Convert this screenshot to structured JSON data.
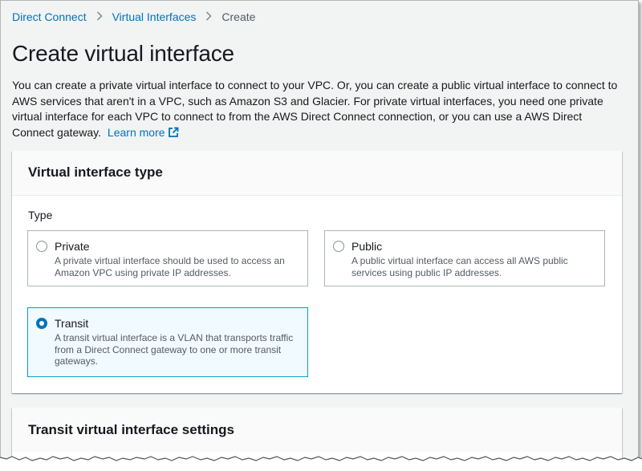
{
  "breadcrumb": {
    "items": [
      "Direct Connect",
      "Virtual Interfaces",
      "Create"
    ]
  },
  "page": {
    "title": "Create virtual interface",
    "intro": "You can create a private virtual interface to connect to your VPC. Or, you can create a public virtual interface to connect to AWS services that aren't in a VPC, such as Amazon S3 and Glacier. For private virtual interfaces, you need one private virtual interface for each VPC to connect to from the AWS Direct Connect connection, or you can use a AWS Direct Connect gateway.",
    "learn_more": "Learn more"
  },
  "vif_type_panel": {
    "title": "Virtual interface type",
    "type_label": "Type",
    "options": [
      {
        "title": "Private",
        "description": "A private virtual interface should be used to access an Amazon VPC using private IP addresses.",
        "selected": false
      },
      {
        "title": "Public",
        "description": "A public virtual interface can access all AWS public services using public IP addresses.",
        "selected": false
      },
      {
        "title": "Transit",
        "description": "A transit virtual interface is a VLAN that transports traffic from a Direct Connect gateway to one or more transit gateways.",
        "selected": true
      }
    ]
  },
  "transit_panel": {
    "title": "Transit virtual interface settings"
  },
  "colors": {
    "link": "#0073bb",
    "selected_bg": "#f1faff",
    "selected_border": "#00a1c9",
    "background": "#f2f3f3"
  }
}
